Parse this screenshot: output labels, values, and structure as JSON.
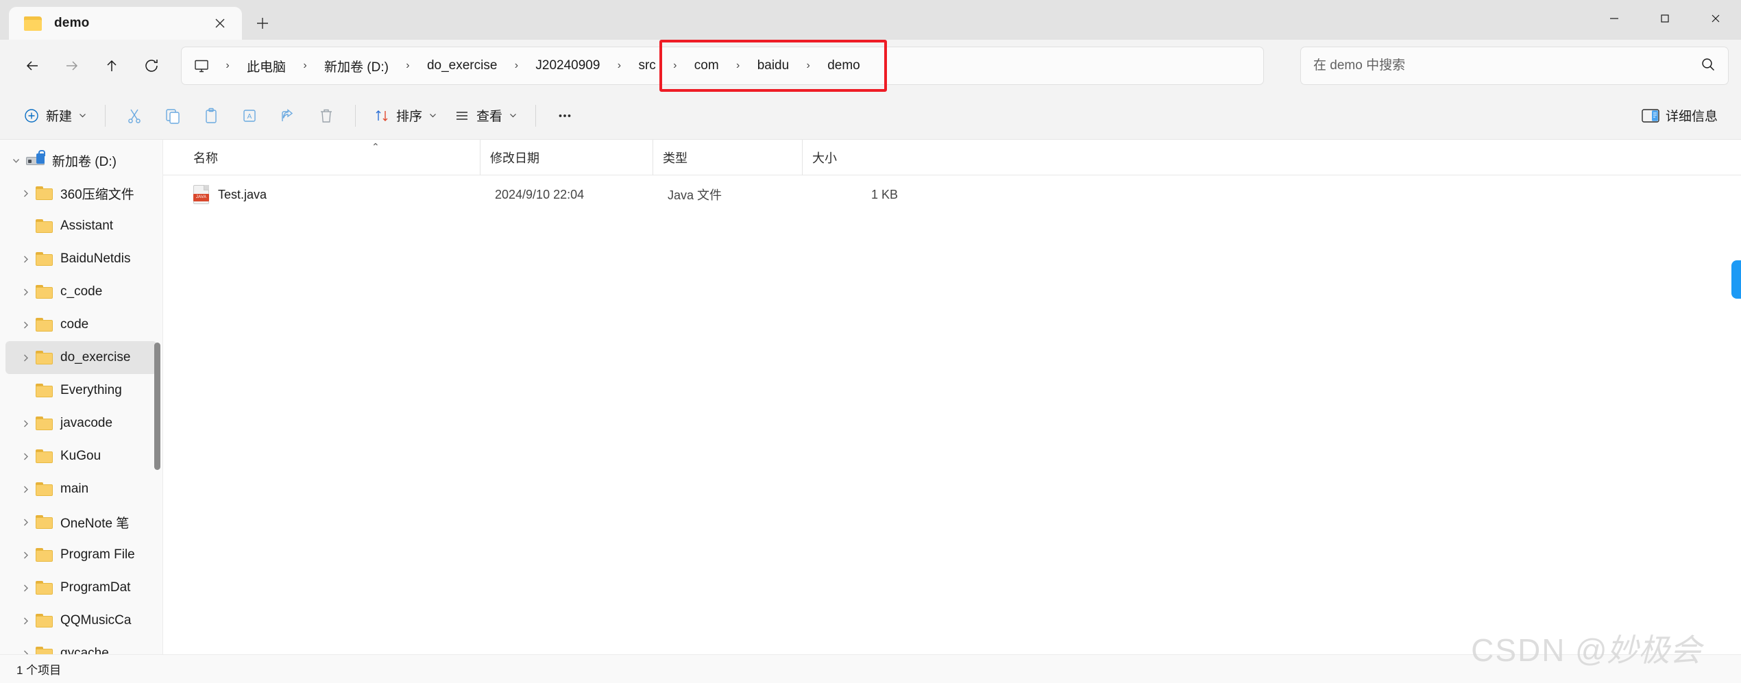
{
  "window": {
    "controls": {
      "minimize": "—",
      "maximize": "□",
      "close": "✕"
    }
  },
  "tabs": [
    {
      "title": "demo",
      "icon": "folder-icon",
      "close_label": "✕",
      "active": true
    }
  ],
  "newtab_label": "+",
  "nav": {
    "back": "←",
    "forward": "→",
    "up": "↑",
    "refresh": "⟳"
  },
  "breadcrumb": {
    "root_icon": "this-pc-icon",
    "separator": "›",
    "items": [
      "此电脑",
      "新加卷 (D:)",
      "do_exercise",
      "J20240909",
      "src",
      "com",
      "baidu",
      "demo"
    ],
    "highlight_color": "#ee1c25",
    "highlighted_items": [
      "com",
      "baidu",
      "demo"
    ]
  },
  "search": {
    "placeholder": "在 demo 中搜索",
    "value": "",
    "icon": "search-icon"
  },
  "toolbar": {
    "new_label": "新建",
    "cut_label": "剪切",
    "copy_label": "复制",
    "paste_label": "粘贴",
    "rename_label": "重命名",
    "share_label": "共享",
    "delete_label": "删除",
    "sort_label": "排序",
    "view_label": "查看",
    "more_label": "•••",
    "details_label": "详细信息",
    "chevron": "⌄"
  },
  "sidebar": {
    "items": [
      {
        "label": "新加卷 (D:)",
        "icon": "drive-icon",
        "expanded": true,
        "level": 0,
        "has_chevron": true,
        "selected": false
      },
      {
        "label": "360压缩文件",
        "icon": "folder-icon",
        "expanded": false,
        "level": 1,
        "has_chevron": true,
        "selected": false
      },
      {
        "label": "Assistant",
        "icon": "folder-icon",
        "expanded": false,
        "level": 1,
        "has_chevron": false,
        "selected": false
      },
      {
        "label": "BaiduNetdis",
        "icon": "folder-icon",
        "expanded": false,
        "level": 1,
        "has_chevron": true,
        "selected": false
      },
      {
        "label": "c_code",
        "icon": "folder-icon",
        "expanded": false,
        "level": 1,
        "has_chevron": true,
        "selected": false
      },
      {
        "label": "code",
        "icon": "folder-icon",
        "expanded": false,
        "level": 1,
        "has_chevron": true,
        "selected": false
      },
      {
        "label": "do_exercise",
        "icon": "folder-icon",
        "expanded": false,
        "level": 1,
        "has_chevron": true,
        "selected": true
      },
      {
        "label": "Everything",
        "icon": "folder-icon",
        "expanded": false,
        "level": 1,
        "has_chevron": false,
        "selected": false
      },
      {
        "label": "javacode",
        "icon": "folder-icon",
        "expanded": false,
        "level": 1,
        "has_chevron": true,
        "selected": false
      },
      {
        "label": "KuGou",
        "icon": "folder-icon",
        "expanded": false,
        "level": 1,
        "has_chevron": true,
        "selected": false
      },
      {
        "label": "main",
        "icon": "folder-icon",
        "expanded": false,
        "level": 1,
        "has_chevron": true,
        "selected": false
      },
      {
        "label": "OneNote 笔",
        "icon": "folder-icon",
        "expanded": false,
        "level": 1,
        "has_chevron": true,
        "selected": false
      },
      {
        "label": "Program File",
        "icon": "folder-icon",
        "expanded": false,
        "level": 1,
        "has_chevron": true,
        "selected": false
      },
      {
        "label": "ProgramDat",
        "icon": "folder-icon",
        "expanded": false,
        "level": 1,
        "has_chevron": true,
        "selected": false
      },
      {
        "label": "QQMusicCa",
        "icon": "folder-icon",
        "expanded": false,
        "level": 1,
        "has_chevron": true,
        "selected": false
      },
      {
        "label": "qycache",
        "icon": "folder-icon",
        "expanded": false,
        "level": 1,
        "has_chevron": true,
        "selected": false
      }
    ]
  },
  "filelist": {
    "columns": [
      "名称",
      "修改日期",
      "类型",
      "大小"
    ],
    "sort_column": "名称",
    "sort_direction": "asc",
    "sort_caret": "⌃",
    "rows": [
      {
        "name": "Test.java",
        "icon": "java-file-icon",
        "icon_text": "JAVA",
        "modified": "2024/9/10 22:04",
        "type": "Java 文件",
        "size": "1 KB"
      }
    ]
  },
  "statusbar": {
    "item_count": "1 个项目"
  },
  "watermark": {
    "prefix": "CSDN",
    "handle": "@妙极会"
  }
}
